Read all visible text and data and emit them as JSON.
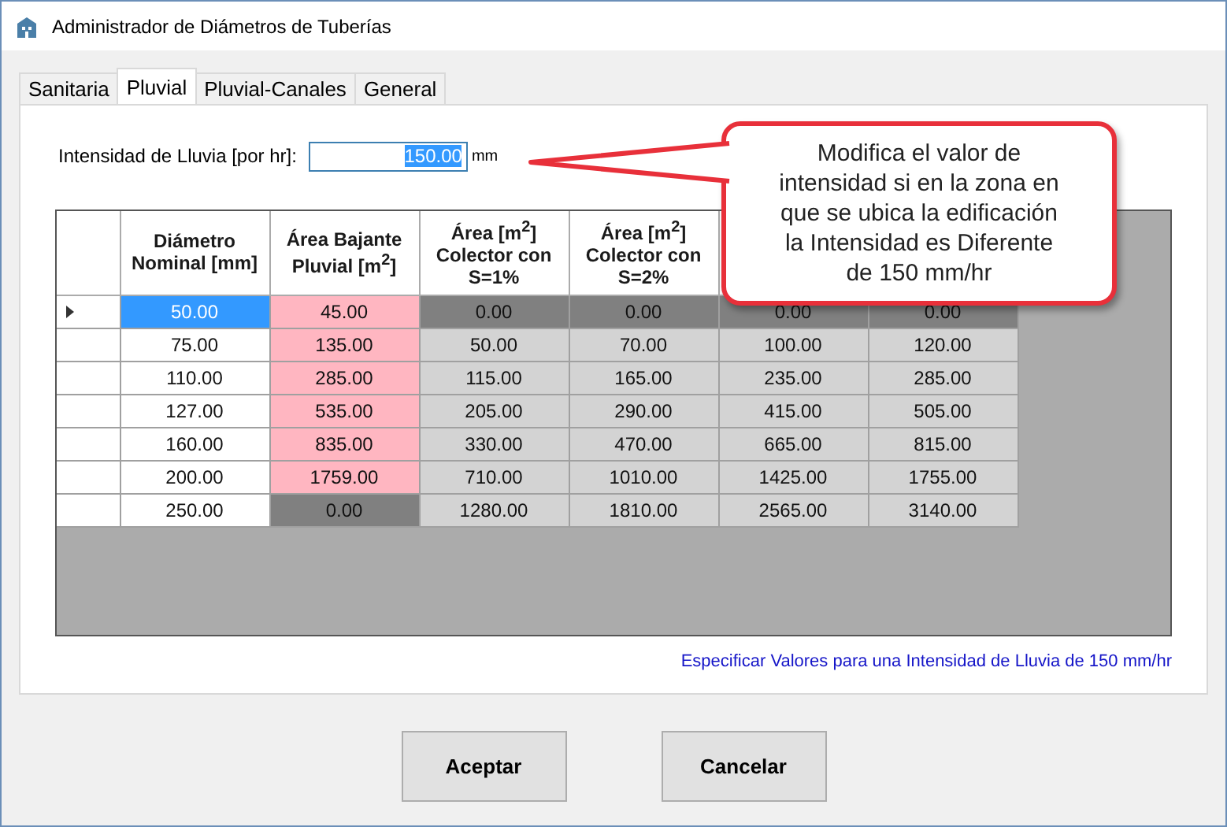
{
  "window": {
    "title": "Administrador de Diámetros de Tuberías"
  },
  "tabs": [
    {
      "label": "Sanitaria",
      "selected": false
    },
    {
      "label": "Pluvial",
      "selected": true
    },
    {
      "label": "Pluvial-Canales",
      "selected": false
    },
    {
      "label": "General",
      "selected": false
    }
  ],
  "intensity": {
    "label": "Intensidad de Lluvia [por hr]:",
    "value": "150.00",
    "unit": "mm"
  },
  "table": {
    "columns": [
      "Diámetro Nominal [mm]",
      "Área Bajante Pluvial [m$^{2}$]",
      "Área [m$^{2}$] Colector con S=1%",
      "Área [m$^{2}$] Colector con S=2%"
    ],
    "rows": [
      {
        "selected": true,
        "cells": [
          {
            "text": "50.00",
            "kind": "current"
          },
          {
            "text": "45.00",
            "kind": "pink"
          },
          {
            "text": "0.00",
            "kind": "dark"
          },
          {
            "text": "0.00",
            "kind": "dark"
          },
          {
            "text": "0.00",
            "kind": "dark"
          },
          {
            "text": "0.00",
            "kind": "dark"
          }
        ]
      },
      {
        "selected": false,
        "cells": [
          {
            "text": "75.00",
            "kind": "plain"
          },
          {
            "text": "135.00",
            "kind": "pink"
          },
          {
            "text": "50.00",
            "kind": "gray"
          },
          {
            "text": "70.00",
            "kind": "gray"
          },
          {
            "text": "100.00",
            "kind": "gray"
          },
          {
            "text": "120.00",
            "kind": "gray"
          }
        ]
      },
      {
        "selected": false,
        "cells": [
          {
            "text": "110.00",
            "kind": "plain"
          },
          {
            "text": "285.00",
            "kind": "pink"
          },
          {
            "text": "115.00",
            "kind": "gray"
          },
          {
            "text": "165.00",
            "kind": "gray"
          },
          {
            "text": "235.00",
            "kind": "gray"
          },
          {
            "text": "285.00",
            "kind": "gray"
          }
        ]
      },
      {
        "selected": false,
        "cells": [
          {
            "text": "127.00",
            "kind": "plain"
          },
          {
            "text": "535.00",
            "kind": "pink"
          },
          {
            "text": "205.00",
            "kind": "gray"
          },
          {
            "text": "290.00",
            "kind": "gray"
          },
          {
            "text": "415.00",
            "kind": "gray"
          },
          {
            "text": "505.00",
            "kind": "gray"
          }
        ]
      },
      {
        "selected": false,
        "cells": [
          {
            "text": "160.00",
            "kind": "plain"
          },
          {
            "text": "835.00",
            "kind": "pink"
          },
          {
            "text": "330.00",
            "kind": "gray"
          },
          {
            "text": "470.00",
            "kind": "gray"
          },
          {
            "text": "665.00",
            "kind": "gray"
          },
          {
            "text": "815.00",
            "kind": "gray"
          }
        ]
      },
      {
        "selected": false,
        "cells": [
          {
            "text": "200.00",
            "kind": "plain"
          },
          {
            "text": "1759.00",
            "kind": "pink"
          },
          {
            "text": "710.00",
            "kind": "gray"
          },
          {
            "text": "1010.00",
            "kind": "gray"
          },
          {
            "text": "1425.00",
            "kind": "gray"
          },
          {
            "text": "1755.00",
            "kind": "gray"
          }
        ]
      },
      {
        "selected": false,
        "cells": [
          {
            "text": "250.00",
            "kind": "plain"
          },
          {
            "text": "0.00",
            "kind": "dark"
          },
          {
            "text": "1280.00",
            "kind": "gray"
          },
          {
            "text": "1810.00",
            "kind": "gray"
          },
          {
            "text": "2565.00",
            "kind": "gray"
          },
          {
            "text": "3140.00",
            "kind": "gray"
          }
        ]
      }
    ]
  },
  "link": "Especificar Valores para una Intensidad de Lluvia de 150 mm/hr",
  "callout": "Modifica el valor de intensidad si en la zona en que se ubica la edificación la Intensidad es Diferente de 150 mm/hr",
  "buttons": [
    "Aceptar",
    "Cancelar"
  ]
}
